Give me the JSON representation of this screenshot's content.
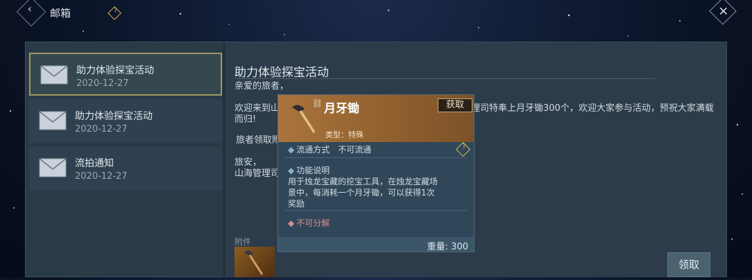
{
  "header": {
    "title": "邮箱",
    "back_icon": "chevron-left-icon",
    "help_icon": "question-icon",
    "close_icon": "close-icon"
  },
  "mail_list": [
    {
      "title": "助力体验探宝活动",
      "date": "2020-12-27",
      "selected": true
    },
    {
      "title": "助力体验探宝活动",
      "date": "2020-12-27",
      "selected": false
    },
    {
      "title": "流拍通知",
      "date": "2020-12-27",
      "selected": false
    }
  ],
  "mail": {
    "title": "助力体验探宝活动",
    "greeting": "亲爱的旅者，",
    "body_left": "欢迎来到山",
    "body_right": "理司特奉上月牙锄300个，欢迎大家参与活动，预祝大家满载",
    "body_end": "而归!",
    "note": "旅者领取附",
    "closing": "旅安，",
    "signature": "山海管理司",
    "attachment_label": "附件",
    "claim_button": "领取"
  },
  "item_tooltip": {
    "name": "月牙锄",
    "get_button": "获取",
    "type": "类型：特殊",
    "circulation": "流通方式　不可流通",
    "function_title": "功能说明",
    "function_desc_1": "用于烛龙宝藏的挖宝工具，在烛龙宝藏场",
    "function_desc_2": "景中，每消耗一个月牙锄，可以获得1次",
    "function_desc_3": "奖励",
    "decompose": "不可分解",
    "weight": "重量: 300",
    "accent_color": "#a9743c",
    "warn_color": "#d98f8f"
  }
}
